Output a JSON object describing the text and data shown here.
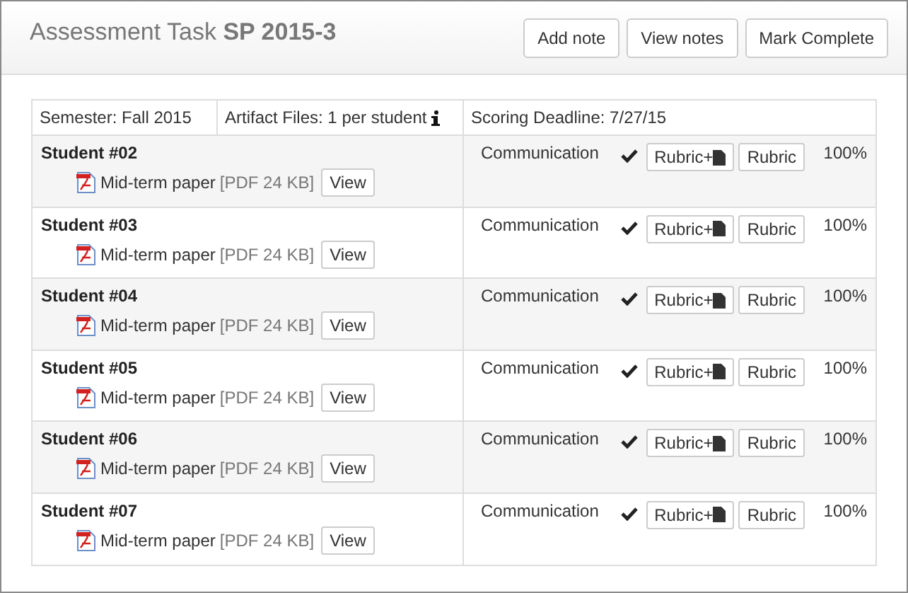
{
  "header": {
    "title": "Assessment Task **SP 2015-3**",
    "buttons": [
      "Add note",
      "View notes",
      "Mark Complete"
    ]
  },
  "info": {
    "semester": "Semester: Fall 2015",
    "artifacts": "Artifact Files: 1 per student",
    "deadline": "Scoring Deadline: 7/27/15"
  },
  "students": [
    {
      "name": "Student #02",
      "file": "Mid-term paper",
      "meta": "[PDF 24 KB]",
      "view": "View",
      "criterion": "Communication",
      "complete": true,
      "rubric_plus": "Rubric+",
      "rubric": "Rubric",
      "score": "100%"
    },
    {
      "name": "Student #03",
      "file": "Mid-term paper",
      "meta": "[PDF 24 KB]",
      "view": "View",
      "criterion": "Communication",
      "complete": true,
      "rubric_plus": "Rubric+",
      "rubric": "Rubric",
      "score": "100%"
    },
    {
      "name": "Student #04",
      "file": "Mid-term paper",
      "meta": "[PDF 24 KB]",
      "view": "View",
      "criterion": "Communication",
      "complete": true,
      "rubric_plus": "Rubric+",
      "rubric": "Rubric",
      "score": "100%"
    },
    {
      "name": "Student #05",
      "file": "Mid-term paper",
      "meta": "[PDF 24 KB]",
      "view": "View",
      "criterion": "Communication",
      "complete": true,
      "rubric_plus": "Rubric+",
      "rubric": "Rubric",
      "score": "100%"
    },
    {
      "name": "Student #06",
      "file": "Mid-term paper",
      "meta": "[PDF 24 KB]",
      "view": "View",
      "criterion": "Communication",
      "complete": true,
      "rubric_plus": "Rubric+",
      "rubric": "Rubric",
      "score": "100%"
    },
    {
      "name": "Student #07",
      "file": "Mid-term paper",
      "meta": "[PDF 24 KB]",
      "view": "View",
      "criterion": "Communication",
      "complete": true,
      "rubric_plus": "Rubric+",
      "rubric": "Rubric",
      "score": "100%"
    }
  ]
}
